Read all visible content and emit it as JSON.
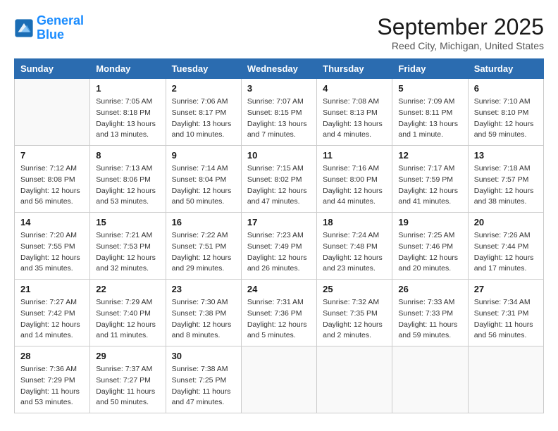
{
  "header": {
    "logo_line1": "General",
    "logo_line2": "Blue",
    "month": "September 2025",
    "location": "Reed City, Michigan, United States"
  },
  "weekdays": [
    "Sunday",
    "Monday",
    "Tuesday",
    "Wednesday",
    "Thursday",
    "Friday",
    "Saturday"
  ],
  "weeks": [
    [
      {
        "day": "",
        "info": ""
      },
      {
        "day": "1",
        "info": "Sunrise: 7:05 AM\nSunset: 8:18 PM\nDaylight: 13 hours\nand 13 minutes."
      },
      {
        "day": "2",
        "info": "Sunrise: 7:06 AM\nSunset: 8:17 PM\nDaylight: 13 hours\nand 10 minutes."
      },
      {
        "day": "3",
        "info": "Sunrise: 7:07 AM\nSunset: 8:15 PM\nDaylight: 13 hours\nand 7 minutes."
      },
      {
        "day": "4",
        "info": "Sunrise: 7:08 AM\nSunset: 8:13 PM\nDaylight: 13 hours\nand 4 minutes."
      },
      {
        "day": "5",
        "info": "Sunrise: 7:09 AM\nSunset: 8:11 PM\nDaylight: 13 hours\nand 1 minute."
      },
      {
        "day": "6",
        "info": "Sunrise: 7:10 AM\nSunset: 8:10 PM\nDaylight: 12 hours\nand 59 minutes."
      }
    ],
    [
      {
        "day": "7",
        "info": "Sunrise: 7:12 AM\nSunset: 8:08 PM\nDaylight: 12 hours\nand 56 minutes."
      },
      {
        "day": "8",
        "info": "Sunrise: 7:13 AM\nSunset: 8:06 PM\nDaylight: 12 hours\nand 53 minutes."
      },
      {
        "day": "9",
        "info": "Sunrise: 7:14 AM\nSunset: 8:04 PM\nDaylight: 12 hours\nand 50 minutes."
      },
      {
        "day": "10",
        "info": "Sunrise: 7:15 AM\nSunset: 8:02 PM\nDaylight: 12 hours\nand 47 minutes."
      },
      {
        "day": "11",
        "info": "Sunrise: 7:16 AM\nSunset: 8:00 PM\nDaylight: 12 hours\nand 44 minutes."
      },
      {
        "day": "12",
        "info": "Sunrise: 7:17 AM\nSunset: 7:59 PM\nDaylight: 12 hours\nand 41 minutes."
      },
      {
        "day": "13",
        "info": "Sunrise: 7:18 AM\nSunset: 7:57 PM\nDaylight: 12 hours\nand 38 minutes."
      }
    ],
    [
      {
        "day": "14",
        "info": "Sunrise: 7:20 AM\nSunset: 7:55 PM\nDaylight: 12 hours\nand 35 minutes."
      },
      {
        "day": "15",
        "info": "Sunrise: 7:21 AM\nSunset: 7:53 PM\nDaylight: 12 hours\nand 32 minutes."
      },
      {
        "day": "16",
        "info": "Sunrise: 7:22 AM\nSunset: 7:51 PM\nDaylight: 12 hours\nand 29 minutes."
      },
      {
        "day": "17",
        "info": "Sunrise: 7:23 AM\nSunset: 7:49 PM\nDaylight: 12 hours\nand 26 minutes."
      },
      {
        "day": "18",
        "info": "Sunrise: 7:24 AM\nSunset: 7:48 PM\nDaylight: 12 hours\nand 23 minutes."
      },
      {
        "day": "19",
        "info": "Sunrise: 7:25 AM\nSunset: 7:46 PM\nDaylight: 12 hours\nand 20 minutes."
      },
      {
        "day": "20",
        "info": "Sunrise: 7:26 AM\nSunset: 7:44 PM\nDaylight: 12 hours\nand 17 minutes."
      }
    ],
    [
      {
        "day": "21",
        "info": "Sunrise: 7:27 AM\nSunset: 7:42 PM\nDaylight: 12 hours\nand 14 minutes."
      },
      {
        "day": "22",
        "info": "Sunrise: 7:29 AM\nSunset: 7:40 PM\nDaylight: 12 hours\nand 11 minutes."
      },
      {
        "day": "23",
        "info": "Sunrise: 7:30 AM\nSunset: 7:38 PM\nDaylight: 12 hours\nand 8 minutes."
      },
      {
        "day": "24",
        "info": "Sunrise: 7:31 AM\nSunset: 7:36 PM\nDaylight: 12 hours\nand 5 minutes."
      },
      {
        "day": "25",
        "info": "Sunrise: 7:32 AM\nSunset: 7:35 PM\nDaylight: 12 hours\nand 2 minutes."
      },
      {
        "day": "26",
        "info": "Sunrise: 7:33 AM\nSunset: 7:33 PM\nDaylight: 11 hours\nand 59 minutes."
      },
      {
        "day": "27",
        "info": "Sunrise: 7:34 AM\nSunset: 7:31 PM\nDaylight: 11 hours\nand 56 minutes."
      }
    ],
    [
      {
        "day": "28",
        "info": "Sunrise: 7:36 AM\nSunset: 7:29 PM\nDaylight: 11 hours\nand 53 minutes."
      },
      {
        "day": "29",
        "info": "Sunrise: 7:37 AM\nSunset: 7:27 PM\nDaylight: 11 hours\nand 50 minutes."
      },
      {
        "day": "30",
        "info": "Sunrise: 7:38 AM\nSunset: 7:25 PM\nDaylight: 11 hours\nand 47 minutes."
      },
      {
        "day": "",
        "info": ""
      },
      {
        "day": "",
        "info": ""
      },
      {
        "day": "",
        "info": ""
      },
      {
        "day": "",
        "info": ""
      }
    ]
  ]
}
